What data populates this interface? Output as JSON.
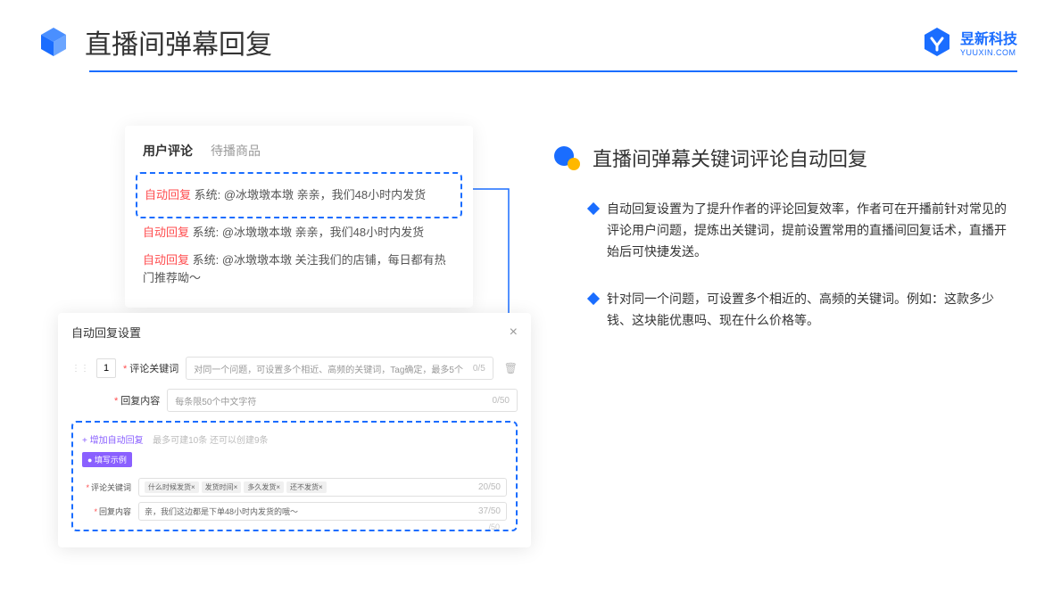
{
  "header": {
    "title": "直播间弹幕回复",
    "logo_cn": "昱新科技",
    "logo_en": "YUUXIN.COM"
  },
  "card_top": {
    "tab_active": "用户评论",
    "tab_inactive": "待播商品",
    "replies": [
      {
        "tag": "自动回复",
        "text": "系统: @冰墩墩本墩 亲亲，我们48小时内发货"
      },
      {
        "tag": "自动回复",
        "text": "系统: @冰墩墩本墩 亲亲，我们48小时内发货"
      },
      {
        "tag": "自动回复",
        "text": "系统: @冰墩墩本墩 关注我们的店铺，每日都有热门推荐呦～"
      }
    ]
  },
  "card_bottom": {
    "title": "自动回复设置",
    "idx": "1",
    "label_keyword": "评论关键词",
    "label_reply": "回复内容",
    "placeholder_keyword": "对同一个问题，可设置多个相近、高频的关键词，Tag确定，最多5个",
    "placeholder_reply": "每条限50个中文字符",
    "counter_kw": "0/5",
    "counter_reply": "0/50",
    "add_link": "+ 增加自动回复",
    "add_hint": "最多可建10条 还可以创建9条",
    "badge": "● 填写示例",
    "ex_label_kw": "评论关键词",
    "ex_label_reply": "回复内容",
    "ex_chips": [
      "什么时候发货×",
      "发货时间×",
      "多久发货×",
      "还不发货×"
    ],
    "ex_kw_counter": "20/50",
    "ex_reply_text": "亲，我们这边都是下单48小时内发货的哦～",
    "ex_reply_counter": "37/50",
    "ghost_counter": "/50"
  },
  "right": {
    "section_title": "直播间弹幕关键词评论自动回复",
    "bullets": [
      "自动回复设置为了提升作者的评论回复效率，作者可在开播前针对常见的评论用户问题，提炼出关键词，提前设置常用的直播间回复话术，直播开始后可快捷发送。",
      "针对同一个问题，可设置多个相近的、高频的关键词。例如：这款多少钱、这块能优惠吗、现在什么价格等。"
    ]
  }
}
